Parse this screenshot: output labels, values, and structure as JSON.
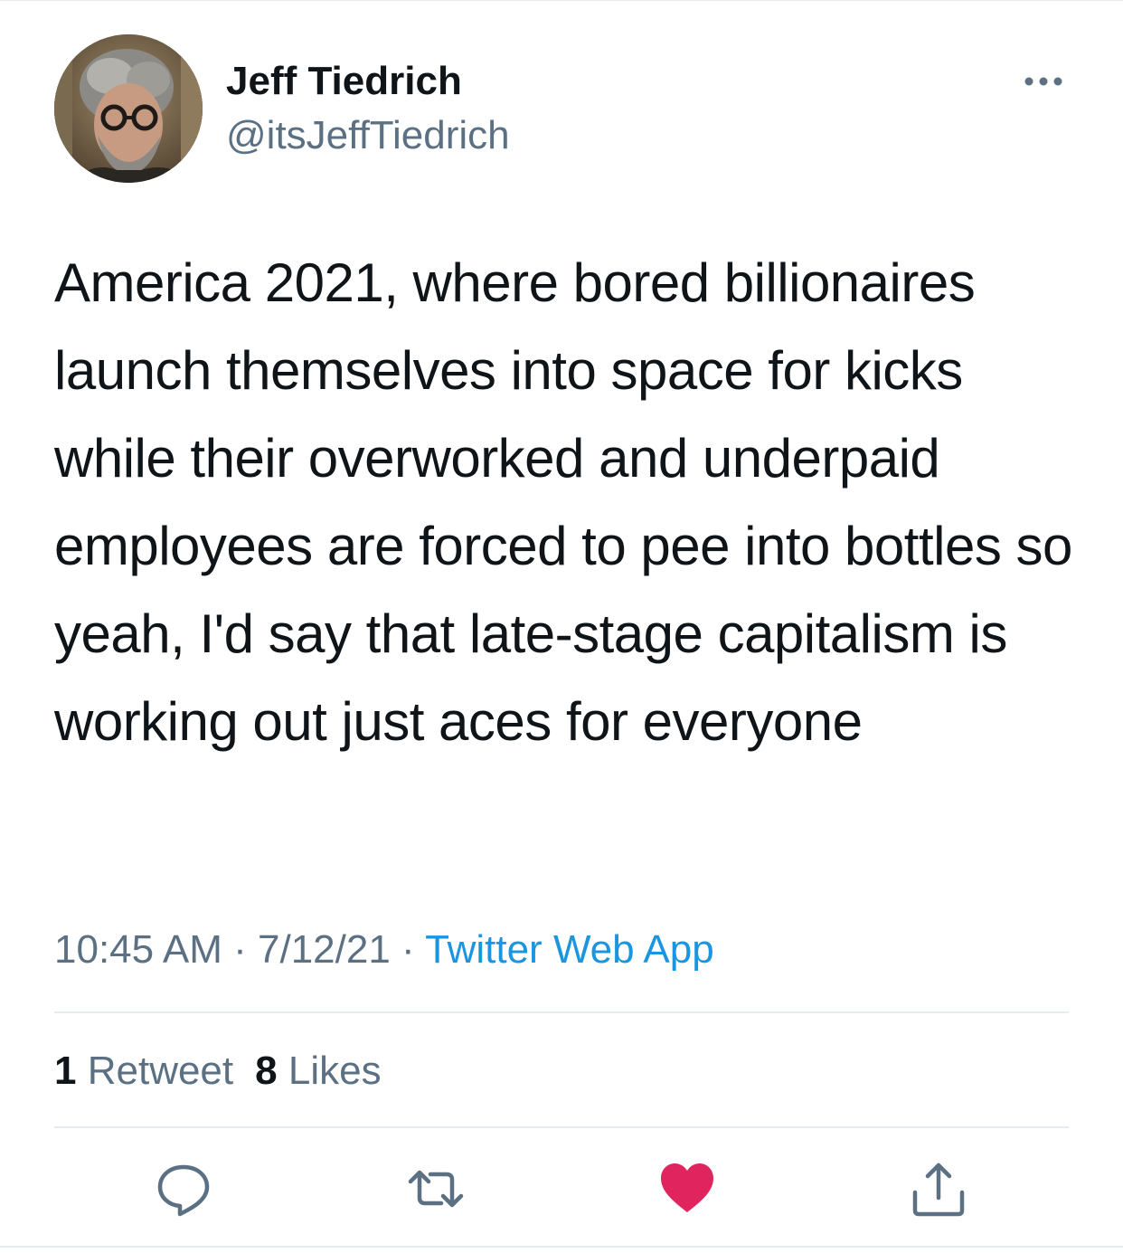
{
  "author": {
    "display_name": "Jeff Tiedrich",
    "handle": "@itsJeffTiedrich"
  },
  "tweet": {
    "text": "America 2021, where bored billionaires launch themselves into space for kicks while their overworked and underpaid employees are forced to pee into bottles so yeah, I'd say that late-stage capitalism is working out just aces for everyone"
  },
  "meta": {
    "time": "10:45 AM",
    "separator": " · ",
    "date": "7/12/21",
    "source": "Twitter Web App"
  },
  "stats": {
    "retweets_count": "1",
    "retweets_label": "Retweet",
    "likes_count": "8",
    "likes_label": "Likes"
  },
  "actions": {
    "reply_icon": "reply-bubble-icon",
    "retweet_icon": "retweet-arrows-icon",
    "like_icon": "heart-icon",
    "share_icon": "share-upload-icon"
  },
  "colors": {
    "text_primary": "#0f1419",
    "text_secondary": "#5b7083",
    "link": "#1b95e0",
    "like_active": "#e0245e",
    "divider": "#e6ecf0"
  }
}
